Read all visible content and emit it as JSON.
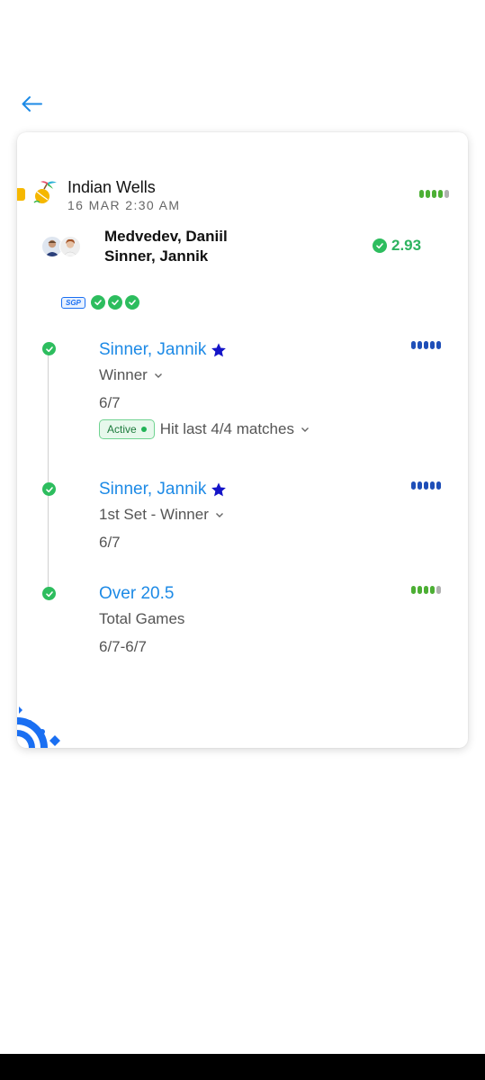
{
  "nav": {
    "back_icon": "arrow-left-icon"
  },
  "event": {
    "name": "Indian Wells",
    "datetime": "16 MAR 2:30 AM",
    "icon": "tennis-palm-icon",
    "confidence_colors": [
      "#4caf34",
      "#4caf34",
      "#4caf34",
      "#4caf34",
      "#b0b0b0"
    ]
  },
  "match": {
    "player1": "Medvedev, Daniil",
    "player2": "Sinner, Jannik",
    "odds": "2.93",
    "status_icon": "check-circle-icon"
  },
  "sgp": {
    "label": "SGP",
    "leg_checks": 3
  },
  "legs": [
    {
      "title": "Sinner, Jannik",
      "market": "Winner",
      "result": "6/7",
      "favorite_icon": "star-icon",
      "active_label": "Active",
      "hit_text": "Hit last 4/4 matches",
      "confidence_colors": [
        "#1f4fb8",
        "#1f4fb8",
        "#1f4fb8",
        "#1f4fb8",
        "#1f4fb8"
      ]
    },
    {
      "title": "Sinner, Jannik",
      "market": "1st Set - Winner",
      "result": "6/7",
      "favorite_icon": "star-icon",
      "confidence_colors": [
        "#1f4fb8",
        "#1f4fb8",
        "#1f4fb8",
        "#1f4fb8",
        "#1f4fb8"
      ]
    },
    {
      "title": "Over 20.5",
      "market": "Total Games",
      "result": "6/7-6/7",
      "confidence_colors": [
        "#4caf34",
        "#4caf34",
        "#4caf34",
        "#4caf34",
        "#b0b0b0"
      ]
    }
  ],
  "colors": {
    "accent_blue": "#1d8ae6",
    "win_green": "#2dbd5e",
    "star_blue": "#1414c8",
    "tab_yellow": "#f6b800"
  }
}
